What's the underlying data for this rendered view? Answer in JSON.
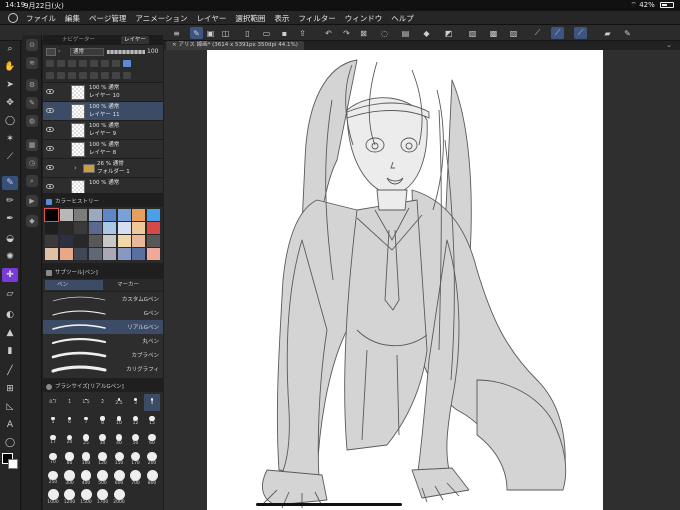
{
  "status_bar": {
    "time": "14:19",
    "date": "9月22日(火)",
    "battery": "42%"
  },
  "menu": {
    "items": [
      "ファイル",
      "編集",
      "ページ管理",
      "アニメーション",
      "レイヤー",
      "選択範囲",
      "表示",
      "フィルター",
      "ウィンドウ",
      "ヘルプ"
    ]
  },
  "panel_tabs": {
    "tab1": "ナビゲーター",
    "tab2": "レイヤー"
  },
  "layer_controls": {
    "blend_mode": "通常",
    "opacity": "100"
  },
  "layers": [
    {
      "line1": "100 % 通常",
      "line2": "レイヤー 10",
      "selected": false,
      "type": "layer"
    },
    {
      "line1": "100 % 通常",
      "line2": "レイヤー 11",
      "selected": true,
      "type": "layer"
    },
    {
      "line1": "100 % 通常",
      "line2": "レイヤー 9",
      "selected": false,
      "type": "layer"
    },
    {
      "line1": "100 % 通常",
      "line2": "レイヤー 8",
      "selected": false,
      "type": "layer"
    },
    {
      "line1": "26 % 通常",
      "line2": "フォルダー 1",
      "selected": false,
      "type": "folder"
    },
    {
      "line1": "100 % 通常",
      "line2": "",
      "selected": false,
      "type": "layer"
    }
  ],
  "color_history": {
    "title": "カラーヒストリー",
    "colors": [
      "#000000",
      "#b8b8b8",
      "#7c7c7c",
      "#9aa8c0",
      "#5e86c8",
      "#7aa0d8",
      "#e5a060",
      "#4aa0e8",
      "#1e1e1e",
      "#2a2a2a",
      "#3a3a3a",
      "#5b6890",
      "#a8c8e8",
      "#d6dff0",
      "#f0c898",
      "#d84848",
      "#3a3a3a",
      "#2c3040",
      "#282828",
      "#585858",
      "#c8c8c8",
      "#f0d8a8",
      "#e8b898",
      "#585858",
      "#e0c0a8",
      "#e8a888",
      "#404858",
      "#606878",
      "#a8a8b8",
      "#8898c0",
      "#5870a0",
      "#f0a898"
    ]
  },
  "sub_tool": {
    "title": "サブツール[ペン]",
    "tab_pen": "ペン",
    "tab_marker": "マーカー"
  },
  "brushes": [
    {
      "name": "カスタムGペン",
      "selected": false
    },
    {
      "name": "Gペン",
      "selected": false
    },
    {
      "name": "リアルGペン",
      "selected": true
    },
    {
      "name": "丸ペン",
      "selected": false
    },
    {
      "name": "カブラペン",
      "selected": false
    },
    {
      "name": "カリグラフィ",
      "selected": false
    }
  ],
  "brush_size": {
    "title": "ブラシサイズ[リアルGペン]",
    "labels_row1": [
      "0.7",
      "1",
      "1.5",
      "2",
      "2.5",
      "3",
      "4"
    ],
    "labels_row2": [
      "5",
      "6",
      "7",
      "8",
      "10",
      "12",
      "15"
    ],
    "labels_row3": [
      "17",
      "20",
      "25",
      "30",
      "40",
      "50",
      "60"
    ],
    "labels_row4": [
      "70",
      "80",
      "100",
      "120",
      "150",
      "170",
      "200"
    ],
    "labels_row5": [
      "250",
      "300",
      "400",
      "500",
      "600",
      "700",
      "800"
    ],
    "labels_row6": [
      "1000",
      "1200",
      "1500",
      "1700",
      "2000"
    ]
  },
  "document": {
    "tab_label": "アリス 線画* (3614 x 5391px 350dpi 44.1%)"
  }
}
